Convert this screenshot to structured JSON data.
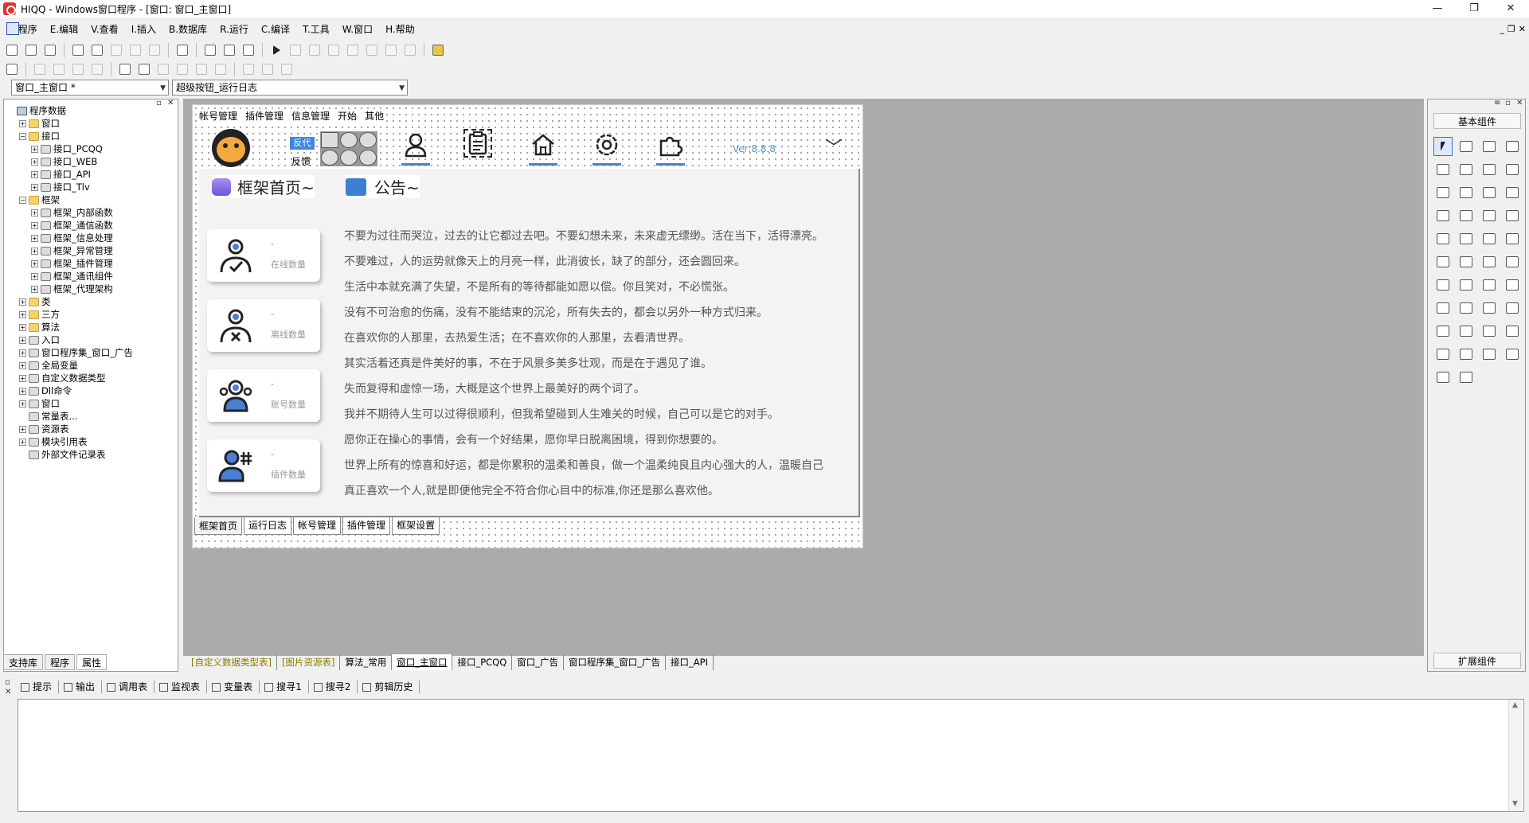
{
  "window": {
    "title": "HIQQ - Windows窗口程序 - [窗口: 窗口_主窗口]",
    "controls": [
      "—",
      "❐",
      "✕"
    ]
  },
  "menu": {
    "items": [
      "F.程序",
      "E.编辑",
      "V.查看",
      "I.插入",
      "B.数据库",
      "R.运行",
      "C.编译",
      "T.工具",
      "W.窗口",
      "H.帮助"
    ],
    "mdi": [
      "_",
      "❐",
      "✕"
    ]
  },
  "selectors": {
    "window_combo": "窗口_主窗口 *",
    "control_combo": "超级按钮_运行日志"
  },
  "tree": {
    "items": [
      {
        "level": 0,
        "exp": "",
        "icon": "root",
        "label": "程序数据"
      },
      {
        "level": 1,
        "exp": "+",
        "icon": "folder",
        "label": "窗口"
      },
      {
        "level": 1,
        "exp": "-",
        "icon": "folder",
        "label": "接口"
      },
      {
        "level": 2,
        "exp": "+",
        "icon": "node",
        "label": "接口_PCQQ"
      },
      {
        "level": 2,
        "exp": "+",
        "icon": "node",
        "label": "接口_WEB"
      },
      {
        "level": 2,
        "exp": "+",
        "icon": "node",
        "label": "接口_API"
      },
      {
        "level": 2,
        "exp": "+",
        "icon": "node",
        "label": "接口_Tlv"
      },
      {
        "level": 1,
        "exp": "-",
        "icon": "folder",
        "label": "框架"
      },
      {
        "level": 2,
        "exp": "+",
        "icon": "node",
        "label": "框架_内部函数"
      },
      {
        "level": 2,
        "exp": "+",
        "icon": "node",
        "label": "框架_通信函数"
      },
      {
        "level": 2,
        "exp": "+",
        "icon": "node",
        "label": "框架_信息处理"
      },
      {
        "level": 2,
        "exp": "+",
        "icon": "node",
        "label": "框架_异常管理"
      },
      {
        "level": 2,
        "exp": "+",
        "icon": "node",
        "label": "框架_插件管理"
      },
      {
        "level": 2,
        "exp": "+",
        "icon": "node",
        "label": "框架_通讯组件"
      },
      {
        "level": 2,
        "exp": "+",
        "icon": "node",
        "label": "框架_代理架构"
      },
      {
        "level": 1,
        "exp": "+",
        "icon": "folder",
        "label": "类"
      },
      {
        "level": 1,
        "exp": "+",
        "icon": "folder",
        "label": "三方"
      },
      {
        "level": 1,
        "exp": "+",
        "icon": "folder",
        "label": "算法"
      },
      {
        "level": 1,
        "exp": "+",
        "icon": "node",
        "label": "入口"
      },
      {
        "level": 1,
        "exp": "+",
        "icon": "node",
        "label": "窗口程序集_窗口_广告"
      },
      {
        "level": 1,
        "exp": "+",
        "icon": "node",
        "label": "全局变量"
      },
      {
        "level": 1,
        "exp": "+",
        "icon": "node",
        "label": "自定义数据类型"
      },
      {
        "level": 1,
        "exp": "+",
        "icon": "node",
        "label": "Dll命令"
      },
      {
        "level": 1,
        "exp": "+",
        "icon": "node",
        "label": "窗口"
      },
      {
        "level": 1,
        "exp": "",
        "icon": "node",
        "label": "常量表..."
      },
      {
        "level": 1,
        "exp": "+",
        "icon": "node",
        "label": "资源表"
      },
      {
        "level": 1,
        "exp": "+",
        "icon": "node",
        "label": "模块引用表"
      },
      {
        "level": 1,
        "exp": "",
        "icon": "node",
        "label": "外部文件记录表"
      }
    ]
  },
  "left_tabs": [
    "支持库",
    "程序",
    "属性"
  ],
  "form": {
    "menu": [
      "帐号管理",
      "插件管理",
      "信息管理",
      "开始",
      "其他"
    ],
    "tag_blue": "反代",
    "tag_feedback": "反馈",
    "version": "Ver:8.8.8",
    "section1": "框架首页~",
    "section2": "公告~",
    "cards": [
      {
        "value": "-",
        "label": "在线数量",
        "icon": "user-check-icon"
      },
      {
        "value": "-",
        "label": "离线数量",
        "icon": "user-x-icon"
      },
      {
        "value": "-",
        "label": "账号数量",
        "icon": "users-icon"
      },
      {
        "value": "-",
        "label": "插件数量",
        "icon": "user-hash-icon"
      }
    ],
    "quotes": [
      "不要为过往而哭泣，过去的让它都过去吧。不要幻想未来，未来虚无缥缈。活在当下，活得漂亮。",
      "不要难过，人的运势就像天上的月亮一样，此消彼长，缺了的部分，还会圆回来。",
      "生活中本就充满了失望，不是所有的等待都能如愿以偿。你且笑对，不必慌张。",
      "没有不可治愈的伤痛，没有不能结束的沉沦，所有失去的，都会以另外一种方式归来。",
      "在喜欢你的人那里，去热爱生活；在不喜欢你的人那里，去看清世界。",
      "其实活着还真是件美好的事，不在于风景多美多壮观，而是在于遇见了谁。",
      "失而复得和虚惊一场，大概是这个世界上最美好的两个词了。",
      "我并不期待人生可以过得很顺利，但我希望碰到人生难关的时候，自己可以是它的对手。",
      "愿你正在操心的事情，会有一个好结果，愿你早日脱离困境，得到你想要的。",
      "世界上所有的惊喜和好运，都是你累积的温柔和善良，做一个温柔纯良且内心强大的人，温暖自己",
      "真正喜欢一个人,就是即便他完全不符合你心目中的标准,你还是那么喜欢他。"
    ],
    "bottom_tabs": [
      "框架首页",
      "运行日志",
      "帐号管理",
      "插件管理",
      "框架设置"
    ]
  },
  "project_tabs": [
    "[自定义数据类型表]",
    "[图片资源表]",
    "算法_常用",
    "窗口_主窗口",
    "接口_PCQQ",
    "窗口_广告",
    "窗口程序集_窗口_广告",
    "接口_API"
  ],
  "right_panel": {
    "title": "基本组件",
    "bottom": "扩展组件",
    "component_count": 42
  },
  "output_tabs": [
    "提示",
    "输出",
    "调用表",
    "监视表",
    "变量表",
    "搜寻1",
    "搜寻2",
    "剪辑历史"
  ]
}
